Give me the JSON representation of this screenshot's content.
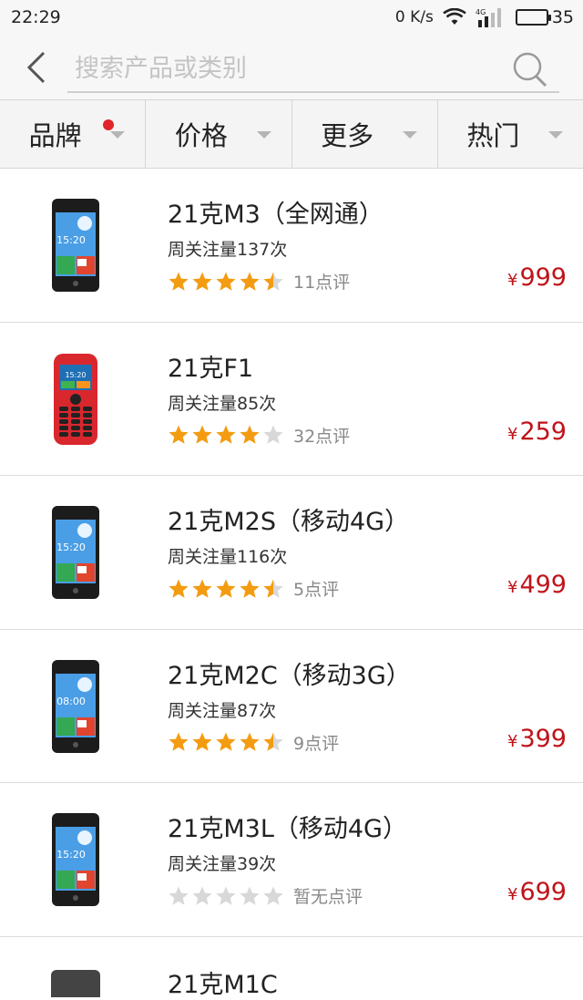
{
  "status_bar": {
    "time": "22:29",
    "net_speed": "0 K/s",
    "network_type": "4G",
    "battery_level": "35",
    "battery_fraction": 0.35
  },
  "search": {
    "placeholder": "搜索产品或类别",
    "value": ""
  },
  "filters": [
    {
      "label": "品牌",
      "has_badge": true
    },
    {
      "label": "价格",
      "has_badge": false
    },
    {
      "label": "更多",
      "has_badge": false
    },
    {
      "label": "热门",
      "has_badge": false
    }
  ],
  "products": [
    {
      "name": "21克M3（全网通）",
      "follow": "周关注量137次",
      "rating": 4.5,
      "reviews": "11点评",
      "price_symbol": "¥",
      "price": "999",
      "phone_style": "smart",
      "screen_time": "15:20"
    },
    {
      "name": "21克F1",
      "follow": "周关注量85次",
      "rating": 4,
      "reviews": "32点评",
      "price_symbol": "¥",
      "price": "259",
      "phone_style": "feature",
      "screen_time": "15:20"
    },
    {
      "name": "21克M2S（移动4G）",
      "follow": "周关注量116次",
      "rating": 4.5,
      "reviews": "5点评",
      "price_symbol": "¥",
      "price": "499",
      "phone_style": "smart",
      "screen_time": "15:20"
    },
    {
      "name": "21克M2C（移动3G）",
      "follow": "周关注量87次",
      "rating": 4.5,
      "reviews": "9点评",
      "price_symbol": "¥",
      "price": "399",
      "phone_style": "smart",
      "screen_time": "08:00"
    },
    {
      "name": "21克M3L（移动4G）",
      "follow": "周关注量39次",
      "rating": 0,
      "reviews": "暂无点评",
      "price_symbol": "¥",
      "price": "699",
      "phone_style": "smart",
      "screen_time": "15:20"
    }
  ],
  "partial_product": {
    "name": "21克M1C"
  },
  "colors": {
    "accent_red": "#c0131a",
    "star_filled": "#f39c12",
    "star_empty": "#d8d8d8"
  }
}
